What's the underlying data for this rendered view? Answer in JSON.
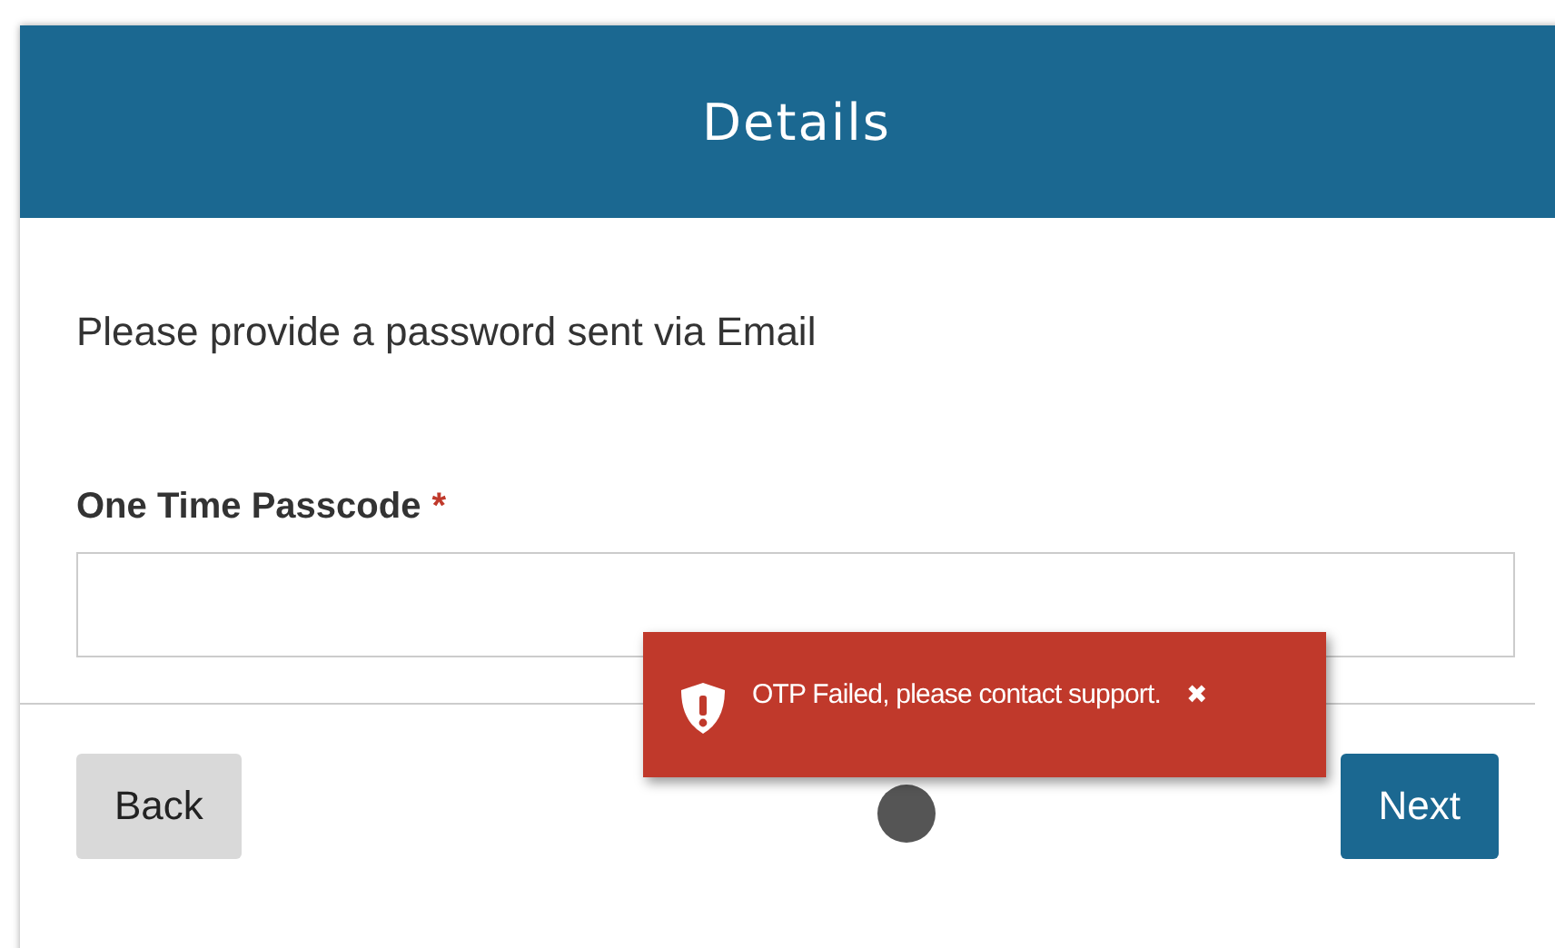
{
  "header": {
    "title": "Details"
  },
  "instruction": "Please provide a password sent via Email",
  "field": {
    "label": "One Time Passcode",
    "required": true,
    "required_mark": "*"
  },
  "buttons": [
    {
      "label": "Back",
      "kind": "secondary"
    },
    {
      "label": "Next",
      "kind": "primary"
    }
  ],
  "toast": {
    "message": "OTP Failed, please contact support.",
    "close": "✖"
  }
}
